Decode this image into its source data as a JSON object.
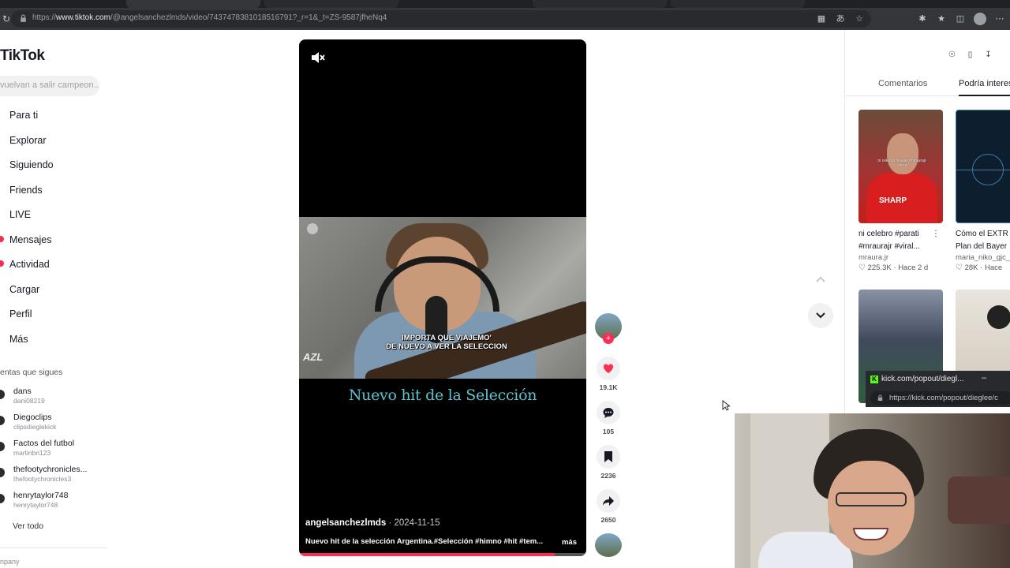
{
  "browser": {
    "url_prefix": "https://",
    "url_domain": "www.tiktok.com",
    "url_rest": "/@angelsanchezlmds/video/7437478381018516791?_r=1&_t=ZS-9587jfheNq4",
    "icons": [
      "reload-icon",
      "lock-icon",
      "translate-icon",
      "star-icon",
      "extensions-icon",
      "favorites-icon",
      "profile-icon",
      "menu-icon"
    ]
  },
  "sidebar": {
    "logo": "TikTok",
    "search_placeholder": "vuelvan a salir campeon...",
    "nav": [
      {
        "label": "Para ti"
      },
      {
        "label": "Explorar"
      },
      {
        "label": "Siguiendo"
      },
      {
        "label": "Friends"
      },
      {
        "label": "LIVE"
      },
      {
        "label": "Mensajes",
        "badge": true
      },
      {
        "label": "Actividad",
        "badge": true
      },
      {
        "label": "Cargar"
      },
      {
        "label": "Perfil"
      },
      {
        "label": "Más"
      }
    ],
    "following_title": "entas que sigues",
    "accounts": [
      {
        "name": "dans",
        "handle": "dani08219"
      },
      {
        "name": "Diegoclips",
        "handle": "clipsdieglekick"
      },
      {
        "name": "Factos del futbol",
        "handle": "martinbri123"
      },
      {
        "name": "thefootychronicles...",
        "handle": "thefootychronicles3"
      },
      {
        "name": "henrytaylor748",
        "handle": "henrytaylor748"
      }
    ],
    "see_all": "Ver todo",
    "company": "npany"
  },
  "video": {
    "caption_line1": "IMPORTA QUE VIAJEMO'",
    "caption_line2": "DE NUEVO A VER LA SELECCION",
    "watermark": "AZL",
    "title_overlay": "Nuevo hit de la Selección",
    "author": "angelsanchezlmds",
    "date": "2024-11-15",
    "description": "Nuevo hit de la selección Argentina.#Selección #himno #hit #tem...",
    "more": "más",
    "progress": 0.89
  },
  "actions": {
    "likes": "19.1K",
    "comments": "105",
    "saves": "2236",
    "shares": "2650"
  },
  "right_panel": {
    "tabs": [
      "Comentarios",
      "Podría interesarte"
    ],
    "active_tab": 1,
    "cards": [
      {
        "title": "ni celebro #parati",
        "title2": "#mraurajr #viral...",
        "user": "mraura.jr",
        "likes": "225.3K",
        "age": "Hace 2 d",
        "thumb_text": "ni celebro #parati #mraurajr #viral"
      },
      {
        "title": "Cómo el EXTR",
        "title2": "Plan del Bayer",
        "user": "maria_niko_gjc_",
        "likes": "28K",
        "age": "Hace"
      },
      {
        "title": "",
        "user": ""
      },
      {
        "title": "",
        "user": ""
      }
    ],
    "thumb1_brand": "SHARP"
  },
  "kick_popup": {
    "title": "kick.com/popout/diegl...",
    "url": "https://kick.com/popout/dieglee/c"
  }
}
